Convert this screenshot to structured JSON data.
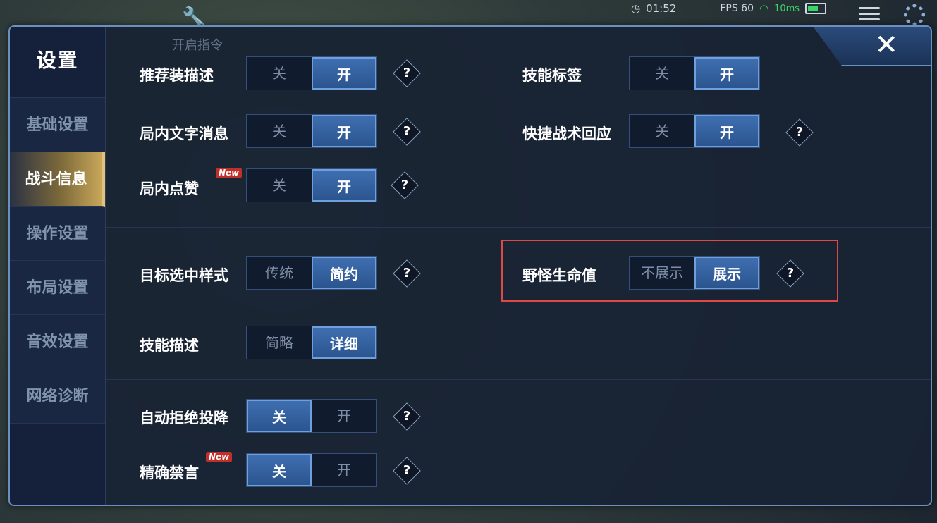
{
  "hud": {
    "time": "01:52",
    "fps": "FPS 60",
    "ping": "10ms",
    "command_label": "开启指令"
  },
  "dialog": {
    "title": "设置",
    "close_glyph": "✕"
  },
  "sidebar": {
    "items": [
      {
        "label": "基础设置",
        "active": false
      },
      {
        "label": "战斗信息",
        "active": true
      },
      {
        "label": "操作设置",
        "active": false
      },
      {
        "label": "布局设置",
        "active": false
      },
      {
        "label": "音效设置",
        "active": false
      },
      {
        "label": "网络诊断",
        "active": false
      }
    ]
  },
  "settings": {
    "recommend_item_desc": {
      "label": "推荐装描述",
      "off": "关",
      "on": "开",
      "selected": "on"
    },
    "skill_tag": {
      "label": "技能标签",
      "off": "关",
      "on": "开",
      "selected": "on"
    },
    "in_game_text": {
      "label": "局内文字消息",
      "off": "关",
      "on": "开",
      "selected": "on"
    },
    "quick_tactic": {
      "label": "快捷战术回应",
      "off": "关",
      "on": "开",
      "selected": "on"
    },
    "in_game_like": {
      "label": "局内点赞",
      "badge": "New",
      "off": "关",
      "on": "开",
      "selected": "on"
    },
    "target_style": {
      "label": "目标选中样式",
      "off": "传统",
      "on": "简约",
      "selected": "on"
    },
    "monster_hp": {
      "label": "野怪生命值",
      "off": "不展示",
      "on": "展示",
      "selected": "on"
    },
    "skill_desc": {
      "label": "技能描述",
      "off": "简略",
      "on": "详细",
      "selected": "on"
    },
    "auto_reject_surrender": {
      "label": "自动拒绝投降",
      "off": "关",
      "on": "开",
      "selected": "off"
    },
    "precise_mute": {
      "label": "精确禁言",
      "badge": "New",
      "off": "关",
      "on": "开",
      "selected": "off"
    }
  },
  "help_glyph": "?",
  "colors": {
    "accent": "#3f6eb0",
    "highlight": "#e04848",
    "active_tab": "#c9a75a"
  }
}
